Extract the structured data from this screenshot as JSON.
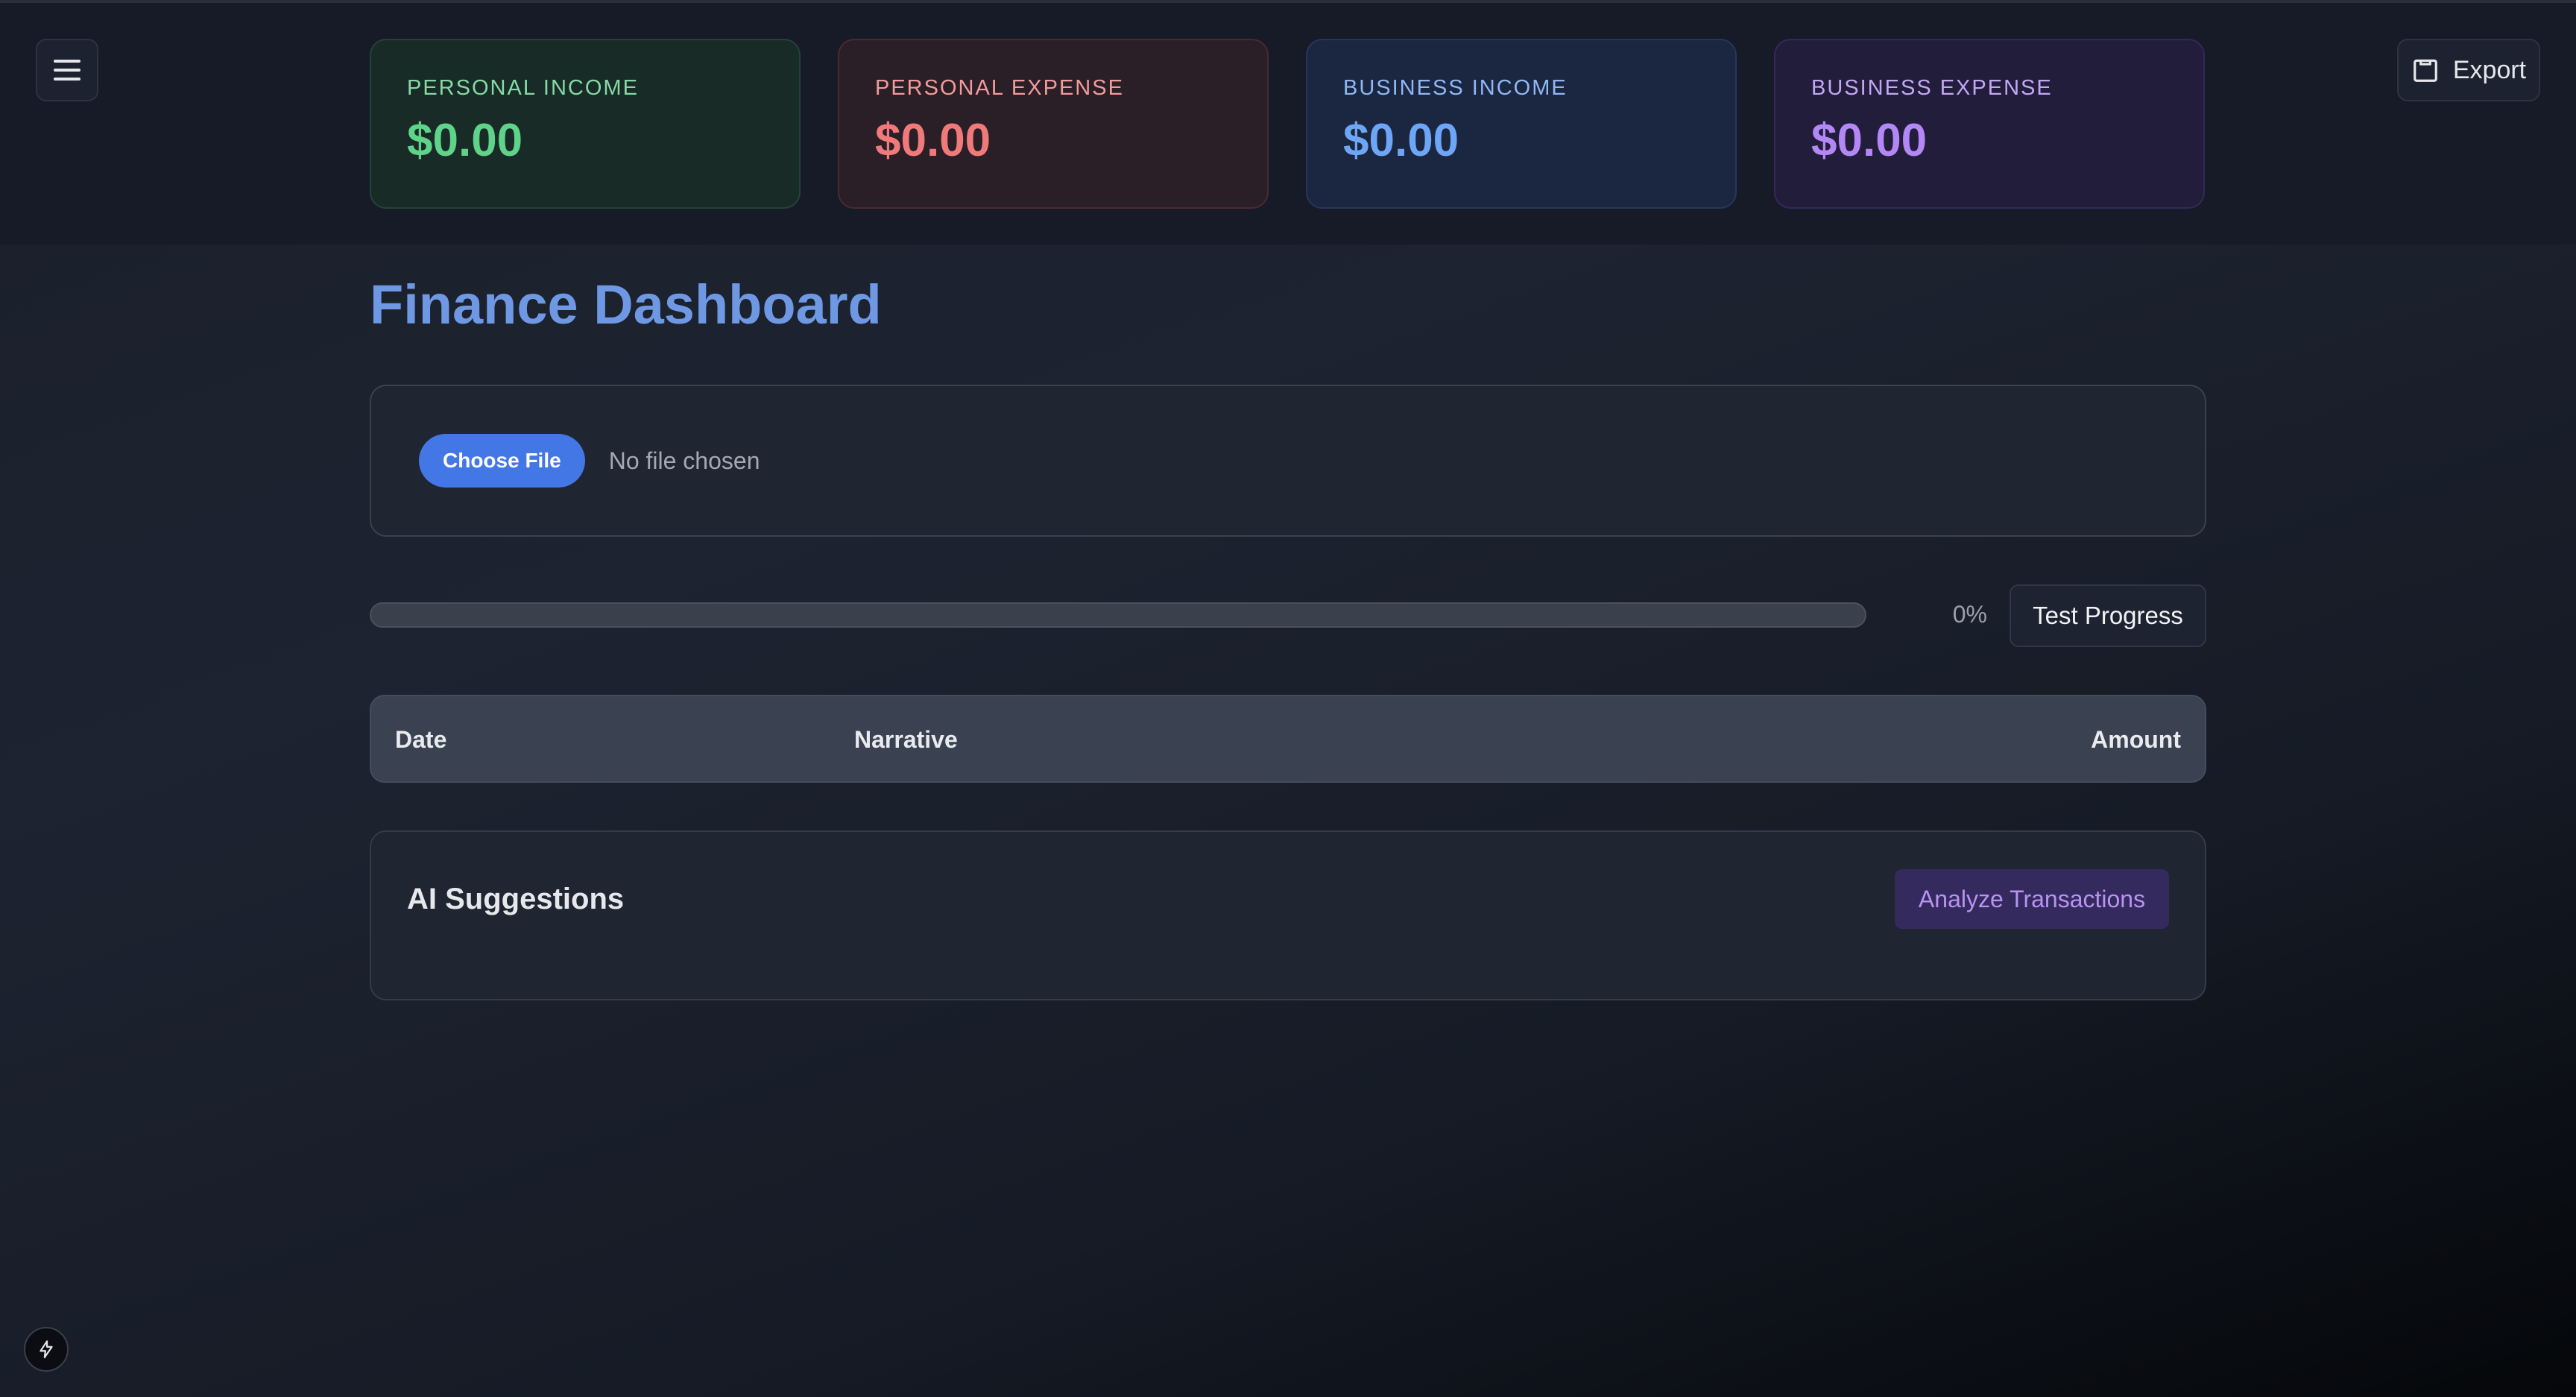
{
  "header": {
    "menu_icon": "hamburger-icon",
    "export_label": "Export",
    "export_icon": "clipboard-icon"
  },
  "cards": {
    "personal_income": {
      "label": "PERSONAL INCOME",
      "value": "$0.00",
      "color": "#5fd38a"
    },
    "personal_expense": {
      "label": "PERSONAL EXPENSE",
      "value": "$0.00",
      "color": "#f07a7a"
    },
    "business_income": {
      "label": "BUSINESS INCOME",
      "value": "$0.00",
      "color": "#6da6f6"
    },
    "business_expense": {
      "label": "BUSINESS EXPENSE",
      "value": "$0.00",
      "color": "#b487f6"
    }
  },
  "main": {
    "title": "Finance Dashboard",
    "upload": {
      "button_label": "Choose File",
      "status": "No file chosen"
    },
    "progress": {
      "value": 0,
      "label": "0%",
      "test_button": "Test Progress"
    },
    "table": {
      "columns": [
        "Date",
        "Narrative",
        "Amount"
      ],
      "rows": []
    },
    "ai": {
      "title": "AI Suggestions",
      "analyze_button": "Analyze Transactions"
    }
  },
  "footer": {
    "bolt_icon": "bolt-icon"
  },
  "colors": {
    "accent": "#4477e6",
    "title": "#6f98e4",
    "ai_button_bg": "#352a5e",
    "ai_button_text": "#b893f2"
  }
}
